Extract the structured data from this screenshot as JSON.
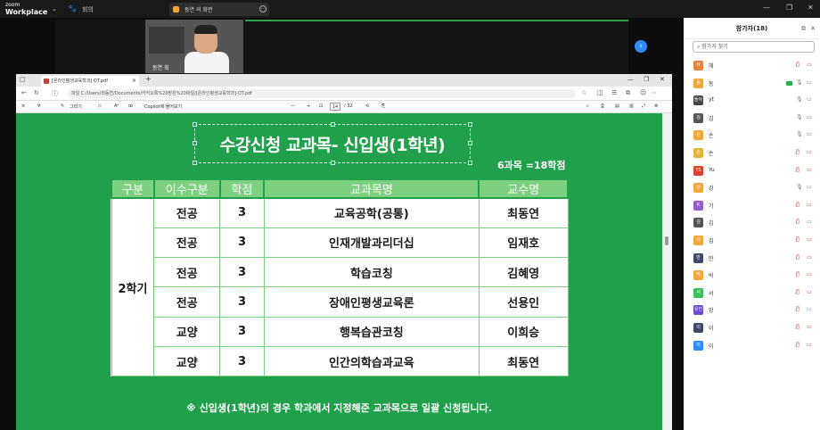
{
  "app": {
    "brand_top": "zoom",
    "brand_bottom": "Workplace",
    "meeting_label": "회의",
    "share_pill_text": "동연 의 화면"
  },
  "video": {
    "participant_name": "동연 최"
  },
  "browser": {
    "tab_title": "[온라인평생교육학과] OT.pdf",
    "address": "파일  C:/Users/최동연/Documents/카카오톡%20받은%20파일/[온라인평생교육학과]-OT.pdf",
    "pdf_toolbar": {
      "draw_label": "그리기",
      "copilot_label": "Copilot에 물어보기",
      "page_current": "14",
      "page_total": "/ 32"
    }
  },
  "slide": {
    "title": "수강신청 교과목- 신입생(1학년)",
    "credits": "6과목 =18학점",
    "headers": [
      "구분",
      "이수구분",
      "학점",
      "교과목명",
      "교수명"
    ],
    "semester": "2학기",
    "rows": [
      [
        "전공",
        "3",
        "교육공학(공통)",
        "최동연"
      ],
      [
        "전공",
        "3",
        "인재개발과리더십",
        "임재호"
      ],
      [
        "전공",
        "3",
        "학습코칭",
        "김혜영"
      ],
      [
        "전공",
        "3",
        "장애인평생교육론",
        "선용인"
      ],
      [
        "교양",
        "3",
        "행복습관코칭",
        "이희승"
      ],
      [
        "교양",
        "3",
        "인간의학습과교육",
        "최동연"
      ]
    ],
    "note": "※ 신입생(1학년)의 경우 학과에서 지정해준 교과목으로 일괄 신청됩니다."
  },
  "participants_panel": {
    "title": "참가자(18)",
    "search_placeholder": "참가자 찾기",
    "participants": [
      {
        "initial": "H",
        "name": "헤",
        "color": "#f0813a"
      },
      {
        "initial": "동",
        "name": "동",
        "color": "#f4a63a"
      },
      {
        "initial": "돌아",
        "name": "yt",
        "color": "#444444"
      },
      {
        "initial": "김",
        "name": "김",
        "color": "#555555"
      },
      {
        "initial": "손",
        "name": "손",
        "color": "#f4a63a"
      },
      {
        "initial": "손",
        "name": "손",
        "color": "#e6b33a"
      },
      {
        "initial": "YS",
        "name": "Yu",
        "color": "#d9412a"
      },
      {
        "initial": "강",
        "name": "강",
        "color": "#f4a63a"
      },
      {
        "initial": "K",
        "name": "기",
        "color": "#9b59d0"
      },
      {
        "initial": "김",
        "name": "김",
        "color": "#555555"
      },
      {
        "initial": "김",
        "name": "김",
        "color": "#f4a63a"
      },
      {
        "initial": "만",
        "name": "만",
        "color": "#3b4a6b"
      },
      {
        "initial": "박",
        "name": "박",
        "color": "#f4a63a"
      },
      {
        "initial": "서",
        "name": "서",
        "color": "#3bbf5b"
      },
      {
        "initial": "유진",
        "name": "앙",
        "color": "#6a4ad0"
      },
      {
        "initial": "이",
        "name": "이",
        "color": "#3b4a6b"
      },
      {
        "initial": "이",
        "name": "이",
        "color": "#2d8cff"
      }
    ]
  }
}
